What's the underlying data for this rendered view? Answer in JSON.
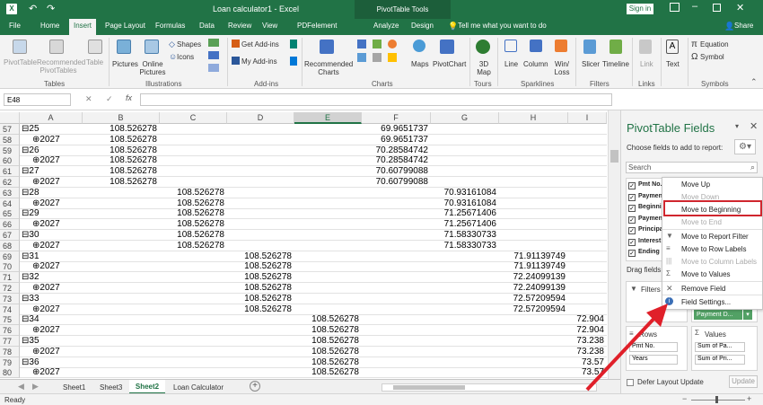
{
  "titlebar": {
    "title": "Loan calculator1 - Excel",
    "context_tab": "PivotTable Tools",
    "signin": "Sign in",
    "window_controls": [
      "minimize-icon",
      "restore-icon",
      "close-icon"
    ]
  },
  "tabs": [
    "File",
    "Home",
    "Insert",
    "Page Layout",
    "Formulas",
    "Data",
    "Review",
    "View",
    "PDFelement",
    "Analyze",
    "Design"
  ],
  "active_tab": "Insert",
  "tell_me": "Tell me what you want to do",
  "share": "Share",
  "ribbon": {
    "tables": {
      "items": [
        "PivotTable",
        "Recommended PivotTables",
        "Table"
      ],
      "label": "Tables"
    },
    "illustrations": {
      "items": [
        "Pictures",
        "Online Pictures",
        "Shapes",
        "Icons"
      ],
      "label": "Illustrations"
    },
    "addins": {
      "items": [
        "Get Add-ins",
        "My Add-ins"
      ],
      "label": "Add-ins"
    },
    "charts": {
      "items": [
        "Recommended Charts",
        "Maps",
        "PivotChart"
      ],
      "label": "Charts"
    },
    "tours": {
      "items": [
        "3D Map"
      ],
      "label": "Tours"
    },
    "sparklines": {
      "items": [
        "Line",
        "Column",
        "Win/ Loss"
      ],
      "label": "Sparklines"
    },
    "filters": {
      "items": [
        "Slicer",
        "Timeline"
      ],
      "label": "Filters"
    },
    "links": {
      "items": [
        "Link"
      ],
      "label": "Links"
    },
    "text": {
      "items": [
        "Text"
      ]
    },
    "symbols": {
      "items": [
        "Equation",
        "Symbol"
      ],
      "label": "Symbols"
    }
  },
  "formula_bar": {
    "name_box": "E48",
    "fx": "fx",
    "value": ""
  },
  "columns": [
    "A",
    "B",
    "C",
    "D",
    "E",
    "F",
    "G",
    "H",
    "I"
  ],
  "rows": [
    {
      "n": "57",
      "a": "⊟25",
      "b": "108.526278",
      "c": "",
      "d": "",
      "e": "",
      "f": "69.9651737",
      "g": "",
      "h": "",
      "i": ""
    },
    {
      "n": "58",
      "a": "⊕2027",
      "b": "108.526278",
      "c": "",
      "d": "",
      "e": "",
      "f": "69.9651737",
      "g": "",
      "h": "",
      "i": ""
    },
    {
      "n": "59",
      "a": "⊟26",
      "b": "108.526278",
      "c": "",
      "d": "",
      "e": "",
      "f": "70.28584742",
      "g": "",
      "h": "",
      "i": ""
    },
    {
      "n": "60",
      "a": "⊕2027",
      "b": "108.526278",
      "c": "",
      "d": "",
      "e": "",
      "f": "70.28584742",
      "g": "",
      "h": "",
      "i": ""
    },
    {
      "n": "61",
      "a": "⊟27",
      "b": "108.526278",
      "c": "",
      "d": "",
      "e": "",
      "f": "70.60799088",
      "g": "",
      "h": "",
      "i": ""
    },
    {
      "n": "62",
      "a": "⊕2027",
      "b": "108.526278",
      "c": "",
      "d": "",
      "e": "",
      "f": "70.60799088",
      "g": "",
      "h": "",
      "i": ""
    },
    {
      "n": "63",
      "a": "⊟28",
      "b": "",
      "c": "108.526278",
      "d": "",
      "e": "",
      "f": "",
      "g": "70.93161084",
      "h": "",
      "i": ""
    },
    {
      "n": "64",
      "a": "⊕2027",
      "b": "",
      "c": "108.526278",
      "d": "",
      "e": "",
      "f": "",
      "g": "70.93161084",
      "h": "",
      "i": ""
    },
    {
      "n": "65",
      "a": "⊟29",
      "b": "",
      "c": "108.526278",
      "d": "",
      "e": "",
      "f": "",
      "g": "71.25671406",
      "h": "",
      "i": ""
    },
    {
      "n": "66",
      "a": "⊕2027",
      "b": "",
      "c": "108.526278",
      "d": "",
      "e": "",
      "f": "",
      "g": "71.25671406",
      "h": "",
      "i": ""
    },
    {
      "n": "67",
      "a": "⊟30",
      "b": "",
      "c": "108.526278",
      "d": "",
      "e": "",
      "f": "",
      "g": "71.58330733",
      "h": "",
      "i": ""
    },
    {
      "n": "68",
      "a": "⊕2027",
      "b": "",
      "c": "108.526278",
      "d": "",
      "e": "",
      "f": "",
      "g": "71.58330733",
      "h": "",
      "i": ""
    },
    {
      "n": "69",
      "a": "⊟31",
      "b": "",
      "c": "",
      "d": "108.526278",
      "e": "",
      "f": "",
      "g": "",
      "h": "71.91139749",
      "i": ""
    },
    {
      "n": "70",
      "a": "⊕2027",
      "b": "",
      "c": "",
      "d": "108.526278",
      "e": "",
      "f": "",
      "g": "",
      "h": "71.91139749",
      "i": ""
    },
    {
      "n": "71",
      "a": "⊟32",
      "b": "",
      "c": "",
      "d": "108.526278",
      "e": "",
      "f": "",
      "g": "",
      "h": "72.24099139",
      "i": ""
    },
    {
      "n": "72",
      "a": "⊕2027",
      "b": "",
      "c": "",
      "d": "108.526278",
      "e": "",
      "f": "",
      "g": "",
      "h": "72.24099139",
      "i": ""
    },
    {
      "n": "73",
      "a": "⊟33",
      "b": "",
      "c": "",
      "d": "108.526278",
      "e": "",
      "f": "",
      "g": "",
      "h": "72.57209594",
      "i": ""
    },
    {
      "n": "74",
      "a": "⊕2027",
      "b": "",
      "c": "",
      "d": "108.526278",
      "e": "",
      "f": "",
      "g": "",
      "h": "72.57209594",
      "i": ""
    },
    {
      "n": "75",
      "a": "⊟34",
      "b": "",
      "c": "",
      "d": "",
      "e": "108.526278",
      "f": "",
      "g": "",
      "h": "",
      "i": "72.904"
    },
    {
      "n": "76",
      "a": "⊕2027",
      "b": "",
      "c": "",
      "d": "",
      "e": "108.526278",
      "f": "",
      "g": "",
      "h": "",
      "i": "72.904"
    },
    {
      "n": "77",
      "a": "⊟35",
      "b": "",
      "c": "",
      "d": "",
      "e": "108.526278",
      "f": "",
      "g": "",
      "h": "",
      "i": "73.238"
    },
    {
      "n": "78",
      "a": "⊕2027",
      "b": "",
      "c": "",
      "d": "",
      "e": "108.526278",
      "f": "",
      "g": "",
      "h": "",
      "i": "73.238"
    },
    {
      "n": "79",
      "a": "⊟36",
      "b": "",
      "c": "",
      "d": "",
      "e": "108.526278",
      "f": "",
      "g": "",
      "h": "",
      "i": "73.57"
    },
    {
      "n": "80",
      "a": "⊕2027",
      "b": "",
      "c": "",
      "d": "",
      "e": "108.526278",
      "f": "",
      "g": "",
      "h": "",
      "i": "73.57"
    }
  ],
  "sheets": [
    "Sheet1",
    "Sheet3",
    "Sheet2",
    "Loan Calculator"
  ],
  "active_sheet": "Sheet2",
  "pane": {
    "title": "PivotTable Fields",
    "subtitle": "Choose fields to add to report:",
    "search": "Search",
    "fields": [
      "Pmt No.",
      "Paymen",
      "Beginnin",
      "Paymen",
      "Principa",
      "Interest",
      "Ending B"
    ],
    "drag_label": "Drag fields",
    "filters": "Filters",
    "filter_chip": "Payment D...",
    "rows_label": "Rows",
    "values_label": "Values",
    "rows_items": [
      "Pmt No.",
      "Years"
    ],
    "values_items": [
      "Sum of Pa...",
      "Sum of Pri..."
    ],
    "defer": "Defer Layout Update",
    "update": "Update"
  },
  "context_menu": [
    {
      "label": "Move Up",
      "enabled": true
    },
    {
      "label": "Move Down",
      "enabled": false
    },
    {
      "label": "Move to Beginning",
      "enabled": true,
      "highlighted": true
    },
    {
      "label": "Move to End",
      "enabled": false
    },
    {
      "label": "Move to Report Filter",
      "enabled": true
    },
    {
      "label": "Move to Row Labels",
      "enabled": true
    },
    {
      "label": "Move to Column Labels",
      "enabled": false
    },
    {
      "label": "Move to Values",
      "enabled": true
    },
    {
      "label": "Remove Field",
      "enabled": true
    },
    {
      "label": "Field Settings...",
      "enabled": true
    }
  ],
  "status": {
    "ready": "Ready"
  },
  "colors": {
    "excel_green": "#217346",
    "highlight_red": "#d0262e",
    "arrow_red": "#e0202a"
  }
}
